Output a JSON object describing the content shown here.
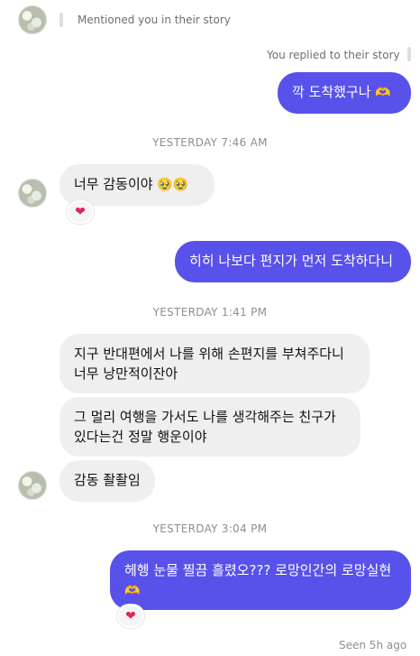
{
  "messages": {
    "mention_note": "Mentioned you in their story",
    "reply_note": "You replied to their story",
    "out1": "깍 도착했구나",
    "out1_emoji": "🫶",
    "ts1": "YESTERDAY 7:46 AM",
    "in1": "너무 감동이야",
    "in1_emoji": "🥹🥹",
    "reaction_heart": "❤",
    "out2": "히히 나보다 편지가 먼저 도착하다니",
    "ts2": "YESTERDAY 1:41 PM",
    "in2": "지구 반대편에서 나를 위해 손편지를 부쳐주다니 너무 낭만적이잔아",
    "in3": "그 멀리 여행을 가서도 나를 생각해주는 친구가 있다는건 정말 행운이야",
    "in4": "감동 좔좔임",
    "ts3": "YESTERDAY 3:04 PM",
    "out3": "헤헹 눈물 찔끔 흘렸오??? 로망인간의 로망실현",
    "out3_emoji": "🫶",
    "seen": "Seen 5h ago"
  },
  "colors": {
    "outgoing_bubble": "#5851ea",
    "incoming_bubble": "#efefef",
    "heart": "#e0245e"
  }
}
